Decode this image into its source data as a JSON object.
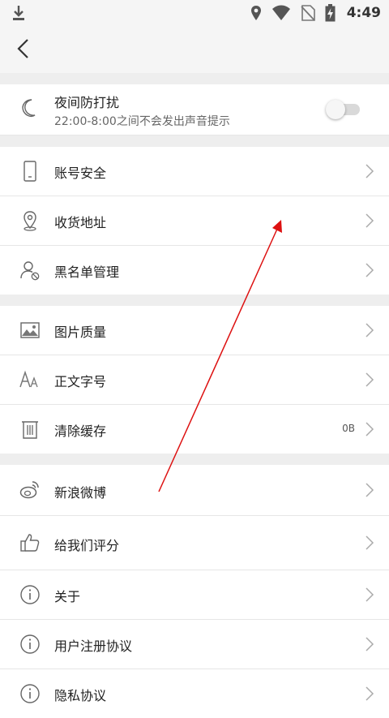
{
  "status_bar": {
    "time": "4:49",
    "icons": [
      "download-icon",
      "location-icon",
      "wifi-icon",
      "no-sim-icon",
      "battery-charging-icon"
    ]
  },
  "app_bar": {
    "back_icon": "back-arrow-icon"
  },
  "night_mode": {
    "title": "夜间防打扰",
    "subtitle": "22:00-8:00之间不会发出声音提示",
    "enabled": false
  },
  "groups": [
    {
      "items": [
        {
          "id": "account",
          "label": "账号安全",
          "icon": "phone-icon"
        },
        {
          "id": "address",
          "label": "收货地址",
          "icon": "location-pin-icon"
        },
        {
          "id": "blacklist",
          "label": "黑名单管理",
          "icon": "user-block-icon"
        }
      ]
    },
    {
      "items": [
        {
          "id": "image-quality",
          "label": "图片质量",
          "icon": "image-icon"
        },
        {
          "id": "font-size",
          "label": "正文字号",
          "icon": "font-size-icon"
        },
        {
          "id": "clear-cache",
          "label": "清除缓存",
          "icon": "trash-icon",
          "value": "0B"
        }
      ]
    },
    {
      "items": [
        {
          "id": "weibo",
          "label": "新浪微博",
          "icon": "weibo-icon"
        },
        {
          "id": "rate",
          "label": "给我们评分",
          "icon": "thumbs-up-icon"
        },
        {
          "id": "about",
          "label": "关于",
          "icon": "info-icon"
        },
        {
          "id": "user-agreement",
          "label": "用户注册协议",
          "icon": "info-icon"
        },
        {
          "id": "privacy",
          "label": "隐私协议",
          "icon": "info-icon"
        }
      ]
    }
  ],
  "colors": {
    "annotation_arrow": "#dd1111",
    "background": "#f2f2f2"
  }
}
